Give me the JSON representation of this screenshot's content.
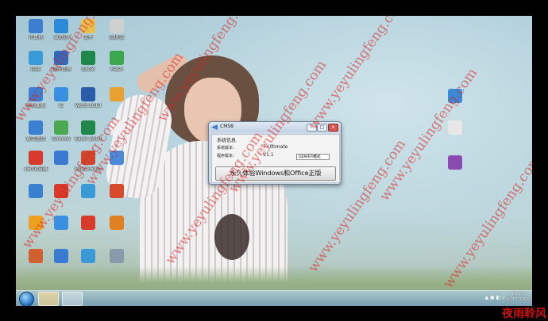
{
  "desktop": {
    "icons": [
      {
        "label": "计算机",
        "color": "#3c7fd1"
      },
      {
        "label": "家庭组",
        "color": "#2c8ad8"
      },
      {
        "label": "文件",
        "color": "#e8c050"
      },
      {
        "label": "回收站",
        "color": "#d0d0d0"
      },
      {
        "label": "网络",
        "color": "#3a9ad8"
      },
      {
        "label": "软件管理",
        "color": "#2b6cc0"
      },
      {
        "label": "Excel",
        "color": "#20874a"
      },
      {
        "label": "Flash",
        "color": "#3aa84a"
      },
      {
        "label": "控制面板",
        "color": "#3d7ed0"
      },
      {
        "label": "IE",
        "color": "#3a90e0"
      },
      {
        "label": "Word 2010",
        "color": "#2a5caa"
      },
      {
        "label": "",
        "color": "#e8a030"
      },
      {
        "label": "宽带连接",
        "color": "#3a80d0"
      },
      {
        "label": "Chrome",
        "color": "#4aa850"
      },
      {
        "label": "Excel 2010",
        "color": "#20874a"
      },
      {
        "label": "",
        "color": "#f0f0f0"
      },
      {
        "label": "360浏览器",
        "color": "#d83a2c"
      },
      {
        "label": "",
        "color": "#3a7ad0"
      },
      {
        "label": "PowerPoint",
        "color": "#d0482c"
      },
      {
        "label": "",
        "color": "#4a8ad8"
      },
      {
        "label": "",
        "color": "#3a80d0"
      },
      {
        "label": "",
        "color": "#d83a2c"
      },
      {
        "label": "",
        "color": "#3a9ad8"
      },
      {
        "label": "",
        "color": "#d84a2c"
      },
      {
        "label": "",
        "color": "#f0a020"
      },
      {
        "label": "",
        "color": "#3a90e0"
      },
      {
        "label": "",
        "color": "#d83a2c"
      },
      {
        "label": "",
        "color": "#e08020"
      },
      {
        "label": "",
        "color": "#d06030"
      },
      {
        "label": "",
        "color": "#3a7ad0"
      },
      {
        "label": "",
        "color": "#3a9ad8"
      },
      {
        "label": "",
        "color": "#8a9aaa"
      },
      {
        "label": "",
        "color": "#d04040"
      }
    ]
  },
  "window": {
    "title": "CMS8",
    "section_label": "系统信息",
    "version_label": "系统版本：",
    "version_value": "7 Ultimate",
    "program_label": "程序版本：",
    "program_value": "V1.1",
    "mode_select": "OEM/EFI模式",
    "activate_button": "永久体验Windows和Office正版"
  },
  "taskbar": {
    "time": "15:26",
    "date": "2017/7/16"
  },
  "watermark": {
    "site": "www.yeyulingfeng.com",
    "corner_text": "夜雨聆风"
  }
}
